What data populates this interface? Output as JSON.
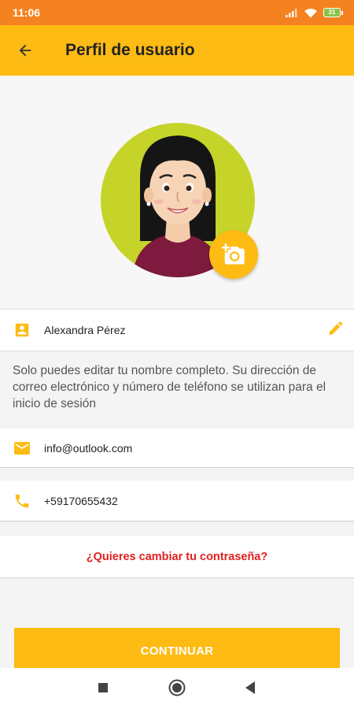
{
  "status_bar": {
    "time": "11:06",
    "battery_level": "31",
    "icons": [
      "signal-icon",
      "wifi-icon",
      "battery-icon"
    ]
  },
  "app_bar": {
    "title": "Perfil de usuario",
    "back_icon": "arrow-back-icon"
  },
  "profile": {
    "avatar": "woman-avatar",
    "camera_icon": "add-photo-icon",
    "full_name": "Alexandra Pérez",
    "name_icon": "contact-card-icon",
    "edit_icon": "pencil-icon"
  },
  "info_text": "Solo puedes editar tu nombre completo. Su dirección de correo electrónico y número de teléfono se utilizan para el inicio de sesión",
  "email": {
    "icon": "email-icon",
    "value": "info@outlook.com"
  },
  "phone": {
    "icon": "phone-icon",
    "value": "+59170655432"
  },
  "change_password_link": "¿Quieres cambiar tu contraseña?",
  "continue_button": "CONTINUAR",
  "colors": {
    "status_bar": "#f58220",
    "primary": "#fdbb13",
    "link": "#e02020",
    "avatar_bg": "#c6d42a"
  },
  "nav_bar": {
    "buttons": [
      "recent-apps-icon",
      "home-icon",
      "back-triangle-icon"
    ]
  }
}
